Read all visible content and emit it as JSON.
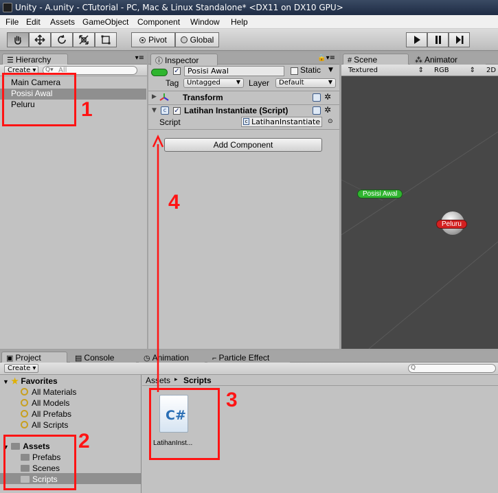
{
  "window": {
    "title": "Unity - A.unity - CTutorial - PC, Mac & Linux Standalone* <DX11 on DX10 GPU>"
  },
  "menu": [
    "File",
    "Edit",
    "Assets",
    "GameObject",
    "Component",
    "Window",
    "Help"
  ],
  "toolbar": {
    "tools": [
      "hand-icon",
      "move-icon",
      "rotate-icon",
      "scale-icon",
      "rect-icon"
    ],
    "pivot_label": "Pivot",
    "global_label": "Global",
    "playback": [
      "play-icon",
      "pause-icon",
      "step-icon"
    ]
  },
  "hierarchy": {
    "tab_label": "Hierarchy",
    "create_label": "Create",
    "search_placeholder": "All",
    "items": [
      {
        "label": "Main Camera",
        "selected": false
      },
      {
        "label": "Posisi Awal",
        "selected": true
      },
      {
        "label": "Peluru",
        "selected": false
      }
    ]
  },
  "inspector": {
    "tab_label": "Inspector",
    "object_name": "Posisi Awal",
    "static_label": "Static",
    "tag_label": "Tag",
    "tag_value": "Untagged",
    "layer_label": "Layer",
    "layer_value": "Default",
    "components": [
      {
        "name": "Transform"
      },
      {
        "name": "Latihan Instantiate (Script)"
      }
    ],
    "script_label": "Script",
    "script_value": "LatihanInstantiate",
    "add_component_label": "Add Component"
  },
  "scene": {
    "tab_scene": "Scene",
    "tab_animator": "Animator",
    "render_mode": "Textured",
    "color_mode": "RGB",
    "view_mode": "2D",
    "labels": [
      "Posisi Awal",
      "Peluru"
    ]
  },
  "bottom_tabs": [
    "Project",
    "Console",
    "Animation",
    "Particle Effect"
  ],
  "project": {
    "create_label": "Create",
    "favorites_label": "Favorites",
    "favorites": [
      "All Materials",
      "All Models",
      "All Prefabs",
      "All Scripts"
    ],
    "assets_label": "Assets",
    "folders": [
      "Prefabs",
      "Scenes",
      "Scripts"
    ],
    "selected_folder": "Scripts",
    "breadcrumb": [
      "Assets",
      "Scripts"
    ],
    "files": [
      {
        "name": "LatihanInst...",
        "icon": "csharp-file-icon",
        "glyph": "C#"
      }
    ]
  },
  "annotations": [
    "1",
    "2",
    "3",
    "4"
  ],
  "colors": {
    "annotation_red": "#ff1414",
    "green_pill": "#2fb52f",
    "red_pill": "#d42020",
    "selection": "#8f8f8f"
  }
}
